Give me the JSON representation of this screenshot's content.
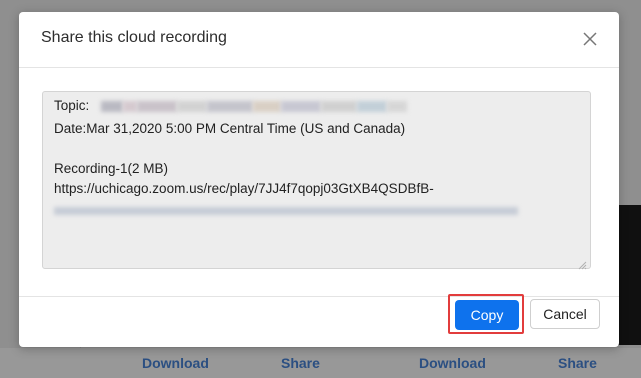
{
  "dialog": {
    "title": "Share this cloud recording",
    "close_icon": "close-icon",
    "share_text": {
      "topic_label": "Topic:",
      "date_line": "Date:Mar 31,2020 5:00 PM Central Time (US and Canada)",
      "recording_line": "Recording-1(2 MB)",
      "url_line": "https://uchicago.zoom.us/rec/play/7JJ4f7qopj03GtXB4QSDBfB-"
    },
    "copy_label": "Copy",
    "cancel_label": "Cancel"
  },
  "background": {
    "links": [
      "Download",
      "Share",
      "Download",
      "Share"
    ]
  },
  "colors": {
    "primary": "#0e72ed",
    "highlight": "#e23c3c",
    "link": "#2b4f82"
  }
}
